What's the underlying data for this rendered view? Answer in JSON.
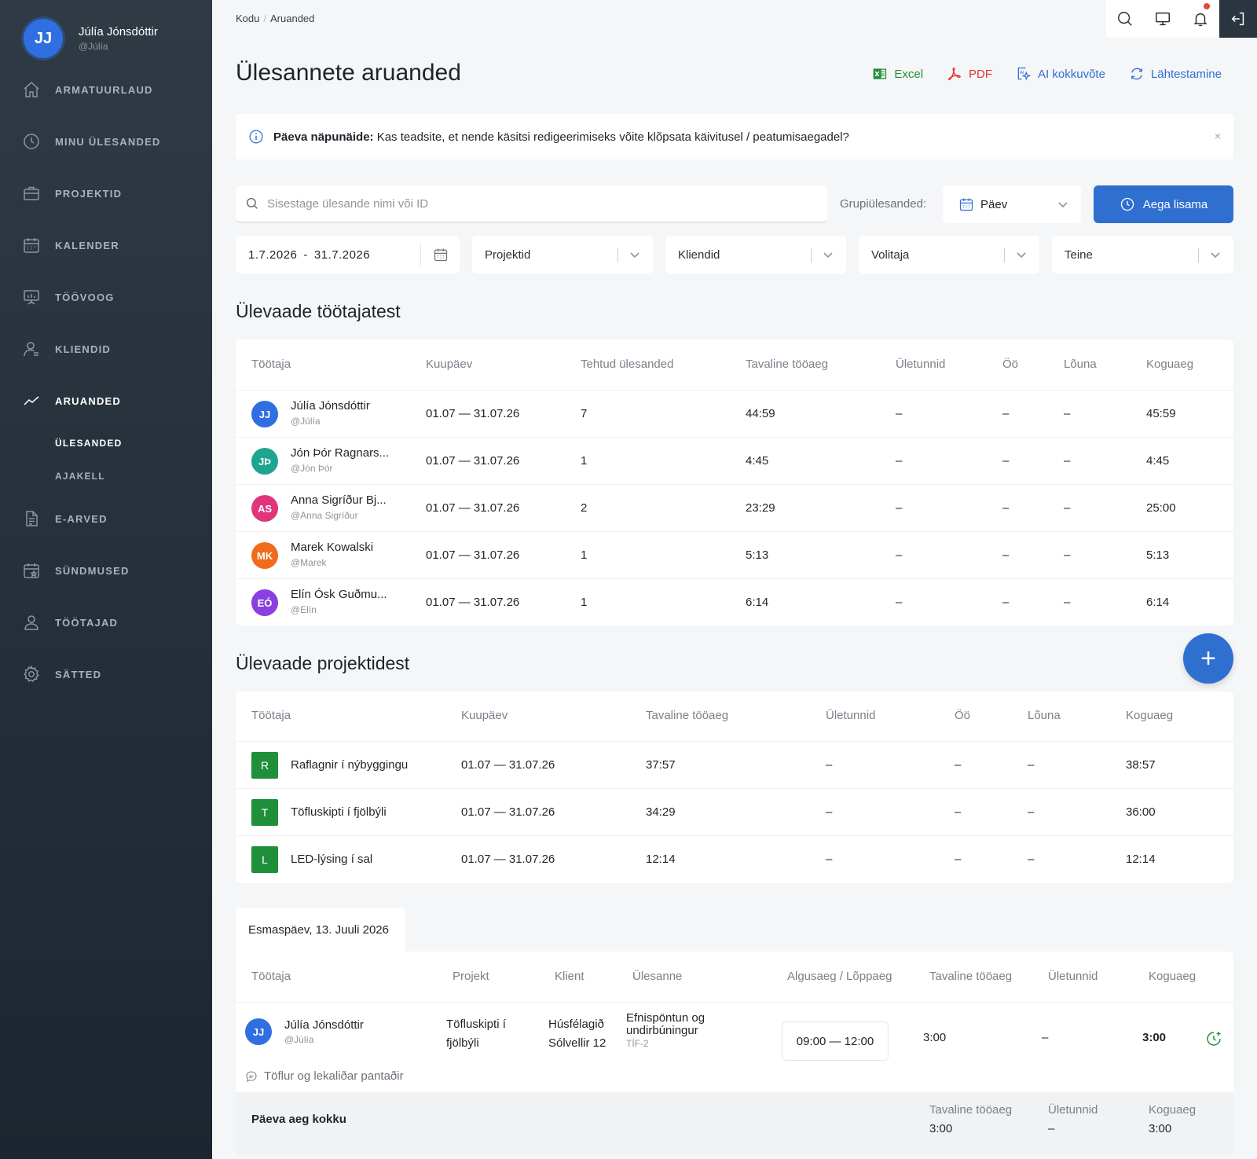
{
  "user": {
    "initials": "JJ",
    "name": "Júlía Jónsdóttir",
    "handle": "@Júlía"
  },
  "nav": {
    "dashboard": "ARMATUURLAUD",
    "my_tasks": "MINU ÜLESANDED",
    "projects": "PROJEKTID",
    "calendar": "KALENDER",
    "workflow": "TÖÖVOOG",
    "clients": "KLIENDID",
    "reports": "ARUANDED",
    "reports_tasks": "ÜLESANDED",
    "reports_timeclock": "AJAKELL",
    "invoices": "E-ARVED",
    "events": "SÜNDMUSED",
    "employees": "TÖÖTAJAD",
    "settings": "SÄTTED"
  },
  "breadcrumb": {
    "home": "Kodu",
    "sep": "/",
    "current": "Aruanded"
  },
  "page_title": "Ülesannete aruanded",
  "actions": {
    "excel": "Excel",
    "pdf": "PDF",
    "ai": "AI kokkuvõte",
    "reset": "Lähtestamine"
  },
  "tip": {
    "bold": "Päeva näpunäide:",
    "text": " Kas teadsite, et nende käsitsi redigeerimiseks võite klõpsata käivitusel / peatumisaegadel?",
    "close": "×"
  },
  "filters": {
    "search_placeholder": "Sisestage ülesande nimi või ID",
    "group_label": "Grupiülesanded:",
    "group_value": "Päev",
    "add_time": "Aega lisama",
    "date_from": "1.7.2026",
    "date_sep": "-",
    "date_to": "31.7.2026",
    "projects": "Projektid",
    "clients": "Kliendid",
    "assignee": "Volitaja",
    "other": "Teine"
  },
  "colors": {
    "accent": "#2f6fd0",
    "excel": "#1f8f3a",
    "pdf": "#e0362c"
  },
  "employees_overview": {
    "title": "Ülevaade töötajatest",
    "headers": {
      "employee": "Töötaja",
      "date": "Kuupäev",
      "done": "Tehtud ülesanded",
      "regular": "Tavaline tööaeg",
      "overtime": "Ületunnid",
      "night": "Öö",
      "lunch": "Lõuna",
      "total": "Koguaeg"
    },
    "rows": [
      {
        "initials": "JJ",
        "color": "#2f6fe0",
        "name": "Júlía Jónsdóttir",
        "handle": "@Júlía",
        "date": "01.07 — 31.07.26",
        "done": "7",
        "regular": "44:59",
        "overtime": "–",
        "night": "–",
        "lunch": "–",
        "total": "45:59"
      },
      {
        "initials": "JÞ",
        "color": "#1fa58f",
        "name": "Jón Þór Ragnars...",
        "handle": "@Jón Þór",
        "date": "01.07 — 31.07.26",
        "done": "1",
        "regular": "4:45",
        "overtime": "–",
        "night": "–",
        "lunch": "–",
        "total": "4:45"
      },
      {
        "initials": "AS",
        "color": "#e0357a",
        "name": "Anna Sigríður Bj...",
        "handle": "@Anna Sigríður",
        "date": "01.07 — 31.07.26",
        "done": "2",
        "regular": "23:29",
        "overtime": "–",
        "night": "–",
        "lunch": "–",
        "total": "25:00"
      },
      {
        "initials": "MK",
        "color": "#f26b1d",
        "name": "Marek Kowalski",
        "handle": "@Marek",
        "date": "01.07 — 31.07.26",
        "done": "1",
        "regular": "5:13",
        "overtime": "–",
        "night": "–",
        "lunch": "–",
        "total": "5:13"
      },
      {
        "initials": "EÓ",
        "color": "#8a3fe0",
        "name": "Elín Ósk Guðmu...",
        "handle": "@Elín",
        "date": "01.07 — 31.07.26",
        "done": "1",
        "regular": "6:14",
        "overtime": "–",
        "night": "–",
        "lunch": "–",
        "total": "6:14"
      }
    ]
  },
  "projects_overview": {
    "title": "Ülevaade projektidest",
    "fab": "+",
    "headers": {
      "employee": "Töötaja",
      "date": "Kuupäev",
      "regular": "Tavaline tööaeg",
      "overtime": "Ületunnid",
      "night": "Öö",
      "lunch": "Lõuna",
      "total": "Koguaeg"
    },
    "rows": [
      {
        "letter": "R",
        "name": "Raflagnir í nýbyggingu",
        "date": "01.07 — 31.07.26",
        "regular": "37:57",
        "overtime": "–",
        "night": "–",
        "lunch": "–",
        "total": "38:57"
      },
      {
        "letter": "T",
        "name": "Töfluskipti í fjölbýli",
        "date": "01.07 — 31.07.26",
        "regular": "34:29",
        "overtime": "–",
        "night": "–",
        "lunch": "–",
        "total": "36:00"
      },
      {
        "letter": "L",
        "name": "LED-lýsing í sal",
        "date": "01.07 — 31.07.26",
        "regular": "12:14",
        "overtime": "–",
        "night": "–",
        "lunch": "–",
        "total": "12:14"
      }
    ]
  },
  "day_detail": {
    "tab": "Esmaspäev, 13. Juuli 2026",
    "headers": {
      "employee": "Töötaja",
      "project": "Projekt",
      "client": "Klient",
      "task": "Ülesanne",
      "startend": "Algusaeg / Lõppaeg",
      "regular": "Tavaline tööaeg",
      "overtime": "Ületunnid",
      "total": "Koguaeg"
    },
    "entry": {
      "initials": "JJ",
      "name": "Júlía Jónsdóttir",
      "handle": "@Júlía",
      "project_l1": "Töfluskipti í",
      "project_l2": "fjölbýli",
      "client_l1": "Húsfélagið",
      "client_l2": "Sólvellir 12",
      "task_l1": "Efnispöntun og",
      "task_l2": "undirbúningur",
      "task_id": "TÍF-2",
      "time": "09:00 — 12:00",
      "regular": "3:00",
      "overtime": "–",
      "total": "3:00",
      "comment": "Töflur og lekaliðar pantaðir"
    },
    "summary": {
      "label": "Päeva aeg kokku",
      "regular_label": "Tavaline tööaeg",
      "regular": "3:00",
      "overtime_label": "Ületunnid",
      "overtime": "–",
      "total_label": "Koguaeg",
      "total": "3:00"
    }
  }
}
